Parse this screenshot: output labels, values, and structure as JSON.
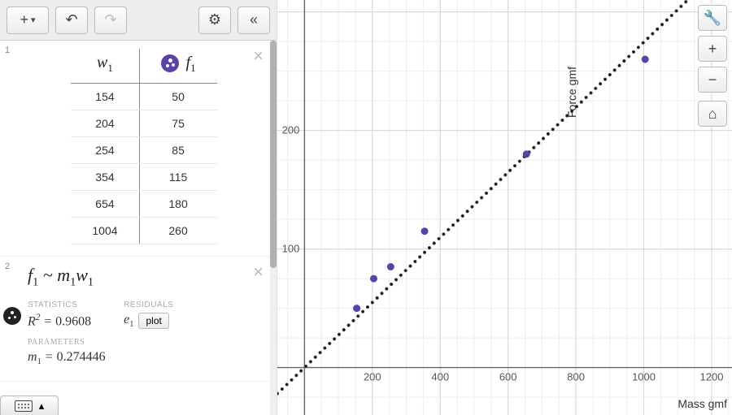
{
  "toolbar": {
    "add_label": "+",
    "undo_label": "↶",
    "redo_label": "↷",
    "settings_label": "⚙",
    "collapse_label": "«"
  },
  "expr1": {
    "index": "1",
    "header_w": "w",
    "header_w_sub": "1",
    "header_f": "f",
    "header_f_sub": "1",
    "rows": [
      {
        "w": "154",
        "f": "50"
      },
      {
        "w": "204",
        "f": "75"
      },
      {
        "w": "254",
        "f": "85"
      },
      {
        "w": "354",
        "f": "115"
      },
      {
        "w": "654",
        "f": "180"
      },
      {
        "w": "1004",
        "f": "260"
      }
    ]
  },
  "expr2": {
    "index": "2",
    "formula_left": "f",
    "formula_left_sub": "1",
    "formula_op": " ~ ",
    "formula_m": "m",
    "formula_m_sub": "1",
    "formula_w": "w",
    "formula_w_sub": "1",
    "stats_label": "STATISTICS",
    "r2_lhs": "R",
    "r2_sup": "2",
    "r2_eq": " = ",
    "r2_val": "0.9608",
    "residuals_label": "RESIDUALS",
    "residuals_e": "e",
    "residuals_e_sub": "1",
    "plot_btn": "plot",
    "params_label": "PARAMETERS",
    "m1_lhs": "m",
    "m1_sub": "1",
    "m1_eq": " = ",
    "m1_val": "0.274446"
  },
  "graph": {
    "ylabel": "Force gmf",
    "xlabel": "Mass gmf",
    "xticks": [
      "200",
      "400",
      "600",
      "800",
      "1000",
      "1200"
    ],
    "yticks": [
      "100",
      "200"
    ],
    "controls": {
      "wrench": "🔧",
      "plus": "+",
      "minus": "−",
      "home": "⌂"
    }
  },
  "chart_data": {
    "type": "scatter",
    "title": "",
    "xlabel": "Mass gmf",
    "ylabel": "Force gmf",
    "xlim": [
      -80,
      1260
    ],
    "ylim": [
      -40,
      310
    ],
    "x": [
      154,
      204,
      254,
      354,
      654,
      1004
    ],
    "y": [
      50,
      75,
      85,
      115,
      180,
      260
    ],
    "fit": {
      "type": "line_through_origin",
      "slope": 0.274446,
      "r_squared": 0.9608
    }
  }
}
